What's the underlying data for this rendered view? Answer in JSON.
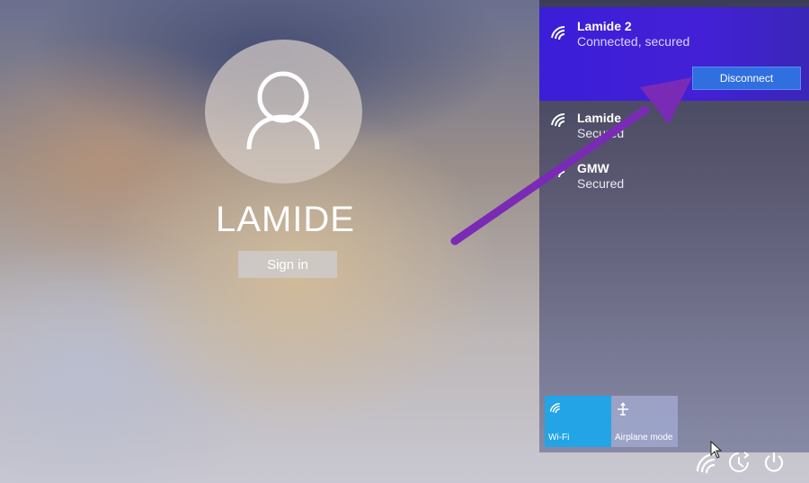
{
  "user": {
    "name": "LAMIDE",
    "sign_in_label": "Sign in"
  },
  "network_panel": {
    "active_network": {
      "name": "Lamide 2",
      "status": "Connected, secured",
      "disconnect_label": "Disconnect"
    },
    "networks": [
      {
        "name": "Lamide",
        "status": "Secured"
      },
      {
        "name": "GMW",
        "status": "Secured"
      }
    ],
    "tiles": [
      {
        "label": "Wi-Fi",
        "icon": "wifi-icon",
        "active": true
      },
      {
        "label": "Airplane mode",
        "icon": "airplane-icon",
        "active": false
      }
    ]
  },
  "system_icons": [
    "network-icon",
    "ease-of-access-icon",
    "power-icon"
  ],
  "colors": {
    "active_network_bg": "#4320d6",
    "disconnect_button": "#2f6fe0",
    "wifi_tile": "#22a4e6",
    "annotation_arrow": "#7a2bb5"
  }
}
